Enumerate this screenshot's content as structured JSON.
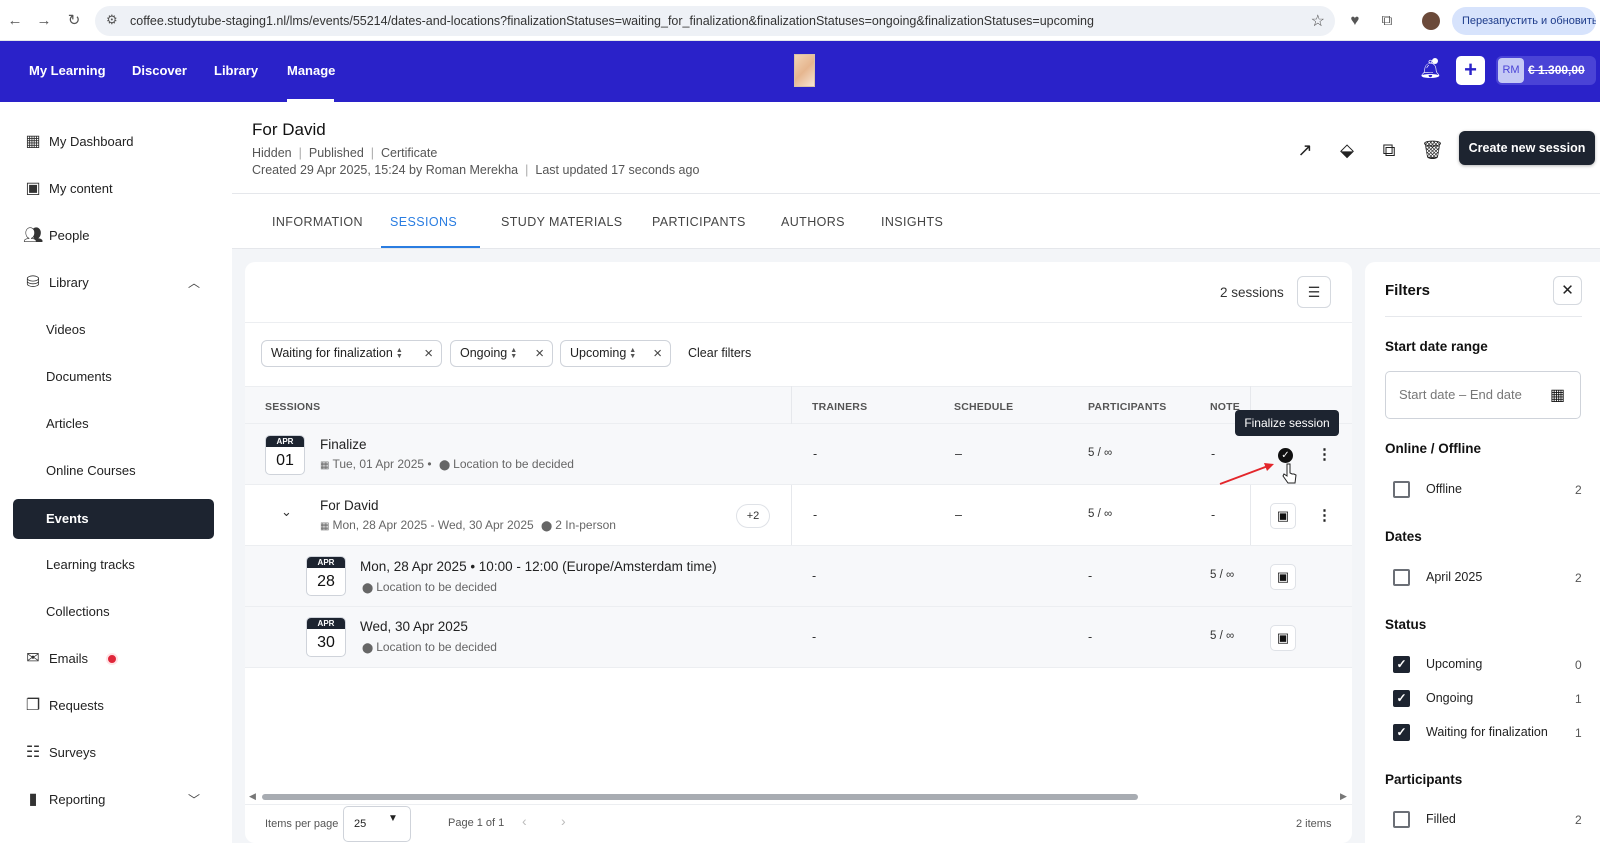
{
  "browser": {
    "url": "coffee.studytube-staging1.nl/lms/events/55214/dates-and-locations?finalizationStatuses=waiting_for_finalization&finalizationStatuses=ongoing&finalizationStatuses=upcoming",
    "restart_label": "Перезапустить и обновить"
  },
  "topnav": {
    "items": [
      "My Learning",
      "Discover",
      "Library",
      "Manage"
    ],
    "active": "Manage",
    "avatar_initials": "RM",
    "credits": "€ 1.300,00"
  },
  "sidebar": {
    "items": [
      {
        "label": "My Dashboard",
        "icon": "dashboard-icon"
      },
      {
        "label": "My content",
        "icon": "content-icon"
      },
      {
        "label": "People",
        "icon": "people-icon"
      },
      {
        "label": "Library",
        "icon": "library-icon"
      },
      {
        "label": "Videos"
      },
      {
        "label": "Documents"
      },
      {
        "label": "Articles"
      },
      {
        "label": "Online Courses"
      },
      {
        "label": "Events"
      },
      {
        "label": "Learning tracks"
      },
      {
        "label": "Collections"
      },
      {
        "label": "Emails",
        "icon": "mail-icon"
      },
      {
        "label": "Requests",
        "icon": "requests-icon"
      },
      {
        "label": "Surveys",
        "icon": "surveys-icon"
      },
      {
        "label": "Reporting",
        "icon": "reporting-icon"
      }
    ],
    "active": "Events"
  },
  "header": {
    "title": "For David",
    "visibility": "Hidden",
    "status": "Published",
    "certificate": "Certificate",
    "created": "Created 29 Apr 2025, 15:24 by Roman Merekha",
    "updated": "Last updated 17 seconds ago",
    "create_button": "Create new session"
  },
  "tabs": [
    "INFORMATION",
    "SESSIONS",
    "STUDY MATERIALS",
    "PARTICIPANTS",
    "AUTHORS",
    "INSIGHTS"
  ],
  "active_tab": "SESSIONS",
  "sessions_count": "2 sessions",
  "chips": [
    "Waiting for finalization",
    "Ongoing",
    "Upcoming"
  ],
  "clear_filters": "Clear filters",
  "table": {
    "columns": [
      "SESSIONS",
      "TRAINERS",
      "SCHEDULE",
      "PARTICIPANTS",
      "NOTE"
    ],
    "rows": [
      {
        "month": "APR",
        "day": "01",
        "name": "Finalize",
        "date": "Tue, 01 Apr 2025 •",
        "location": "Location to be decided",
        "trainers": "-",
        "schedule": "–",
        "participants": "5 / ∞",
        "note": "-"
      },
      {
        "name": "For David",
        "date": "Mon, 28 Apr 2025 - Wed, 30 Apr 2025",
        "location": "2 In-person",
        "extra": "+2",
        "trainers": "-",
        "schedule": "–",
        "participants": "5 / ∞",
        "note": "-"
      },
      {
        "month": "APR",
        "day": "28",
        "name": "Mon, 28 Apr 2025 • 10:00 - 12:00 (Europe/Amsterdam time)",
        "location": "Location to be decided",
        "trainers": "-",
        "schedule": "-",
        "participants": "5 / ∞"
      },
      {
        "month": "APR",
        "day": "30",
        "name": "Wed, 30 Apr 2025",
        "location": "Location to be decided",
        "trainers": "-",
        "schedule": "-",
        "participants": "5 / ∞"
      }
    ]
  },
  "tooltip": "Finalize session",
  "footer": {
    "items_per_page_label": "Items per page",
    "items_per_page": "25",
    "page_info": "Page 1 of 1",
    "items_count": "2 items"
  },
  "filters": {
    "title": "Filters",
    "start_date_range": "Start date range",
    "date_placeholder": "Start date – End date",
    "online_offline": "Online / Offline",
    "offline": {
      "label": "Offline",
      "count": "2"
    },
    "dates": "Dates",
    "april": {
      "label": "April 2025",
      "count": "2"
    },
    "status": "Status",
    "upcoming": {
      "label": "Upcoming",
      "count": "0"
    },
    "ongoing": {
      "label": "Ongoing",
      "count": "1"
    },
    "waiting": {
      "label": "Waiting for finalization",
      "count": "1"
    },
    "participants": "Participants",
    "filled": {
      "label": "Filled",
      "count": "2"
    }
  },
  "colors": {
    "nav": "#2a22c9",
    "dark": "#1d2430",
    "accent": "#2a7de1"
  }
}
